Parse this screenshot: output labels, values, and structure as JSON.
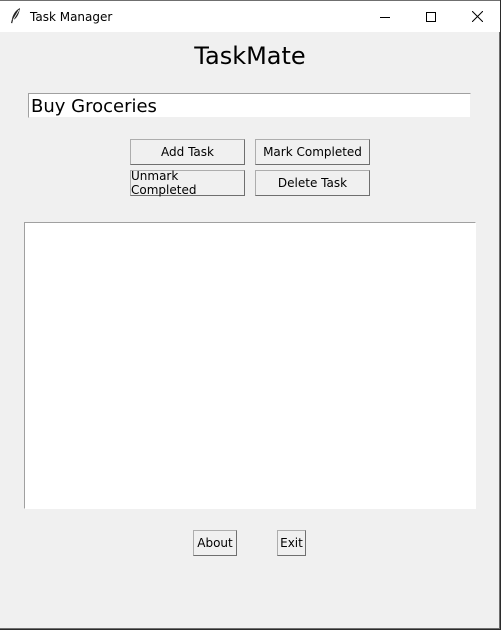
{
  "window": {
    "title": "Task Manager",
    "icon": "feather-icon",
    "controls": [
      "minimize-icon",
      "maximize-icon",
      "close-icon"
    ]
  },
  "app": {
    "heading": "TaskMate"
  },
  "task_entry": {
    "value": "Buy Groceries"
  },
  "buttons": {
    "add": "Add Task",
    "mark": "Mark Completed",
    "unmark": "Unmark Completed",
    "delete": "Delete Task",
    "about": "About",
    "exit": "Exit"
  },
  "task_list": {
    "items": []
  }
}
